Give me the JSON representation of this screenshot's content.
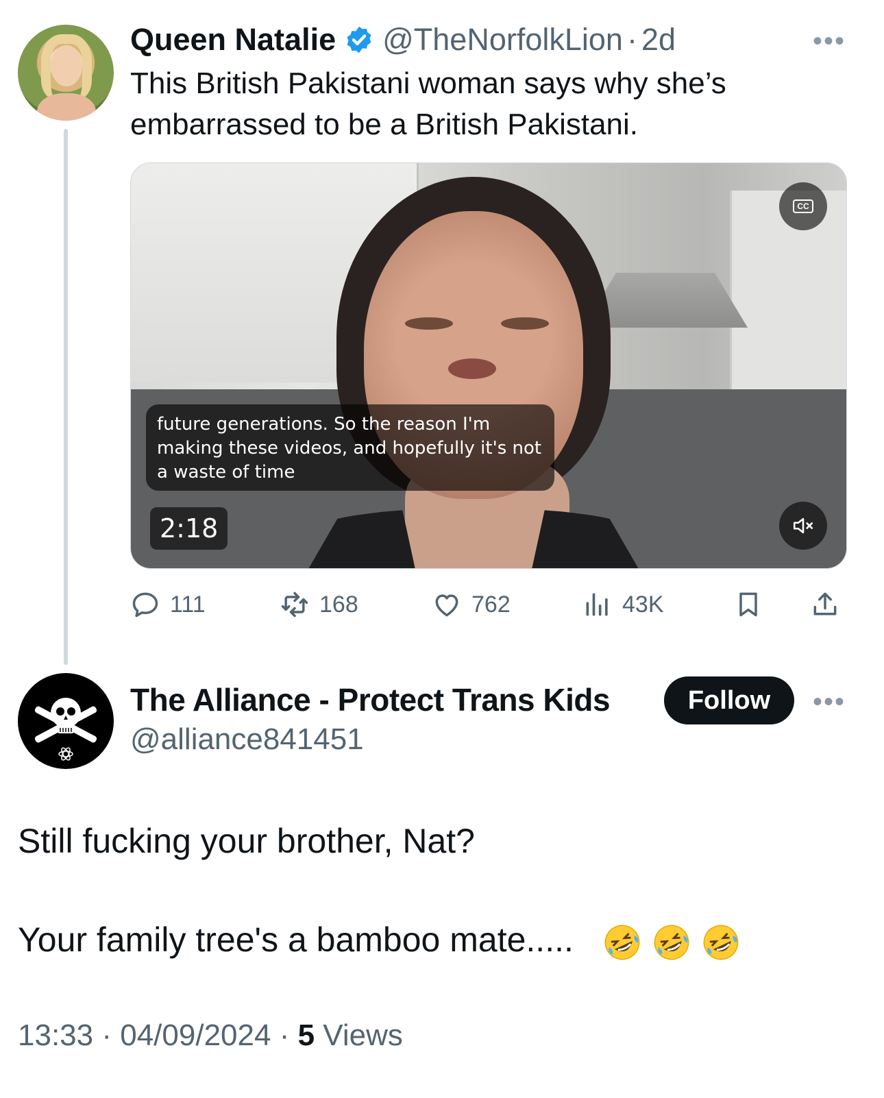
{
  "tweet1": {
    "name": "Queen Natalie",
    "handle": "@TheNorfolkLion",
    "separator": "·",
    "time": "2d",
    "text": "This British Pakistani woman says why she’s embarrassed to be a British Pakistani.",
    "video": {
      "caption": "future generations. So the reason I'm making these videos, and hopefully it's not a waste of time",
      "duration": "2:18",
      "cc_label": "CC"
    },
    "actions": {
      "replies": "111",
      "reposts": "168",
      "likes": "762",
      "views": "43K"
    }
  },
  "tweet2": {
    "name": "The Alliance - Protect Trans Kids",
    "handle": "@alliance841451",
    "follow_label": "Follow",
    "line1": "Still fucking your brother, Nat?",
    "line2": "Your family tree's a bamboo mate.....",
    "time": "13:33",
    "separator": "·",
    "date": "04/09/2024",
    "views_count": "5",
    "views_label": "Views"
  },
  "more_label": "•••",
  "colors": {
    "text_primary": "#0f1419",
    "text_secondary": "#536471",
    "verified_blue": "#1d9bf0",
    "thread_line": "#cfd9de"
  },
  "icons": [
    "verified-badge-icon",
    "more-icon",
    "reply-icon",
    "repost-icon",
    "like-icon",
    "views-icon",
    "bookmark-icon",
    "share-icon",
    "cc-icon",
    "mute-icon",
    "rofl-emoji"
  ]
}
